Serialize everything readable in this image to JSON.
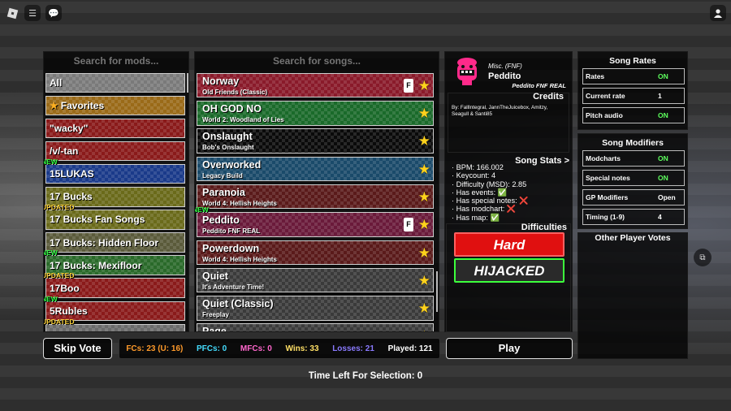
{
  "mods": {
    "search_placeholder": "Search for mods...",
    "items": [
      {
        "label": "All",
        "tag": "",
        "star": false,
        "color": "#7a7a7a"
      },
      {
        "label": "Favorites",
        "tag": "",
        "star": true,
        "color": "#9a6a18"
      },
      {
        "label": "\"wacky\"",
        "tag": "",
        "star": false,
        "color": "#8a1a1a"
      },
      {
        "label": "/v/-tan",
        "tag": "",
        "star": false,
        "color": "#8a1a1a"
      },
      {
        "label": "15LUKAS",
        "tag": "NEW",
        "star": false,
        "color": "#1a3a8a"
      },
      {
        "label": "17 Bucks",
        "tag": "",
        "star": false,
        "color": "#6a6a1a"
      },
      {
        "label": "17 Bucks Fan Songs",
        "tag": "UPDATED",
        "star": false,
        "color": "#6a6a1a"
      },
      {
        "label": "17 Bucks: Hidden Floor",
        "tag": "",
        "star": false,
        "color": "#5a5a3a"
      },
      {
        "label": "17 Bucks: Mexifloor",
        "tag": "NEW",
        "star": false,
        "color": "#2a6a2a"
      },
      {
        "label": "17Boo",
        "tag": "UPDATED",
        "star": false,
        "color": "#8a1a1a"
      },
      {
        "label": "5Rubles",
        "tag": "NEW",
        "star": false,
        "color": "#8a1a1a"
      },
      {
        "label": "",
        "tag": "UPDATED",
        "star": false,
        "color": "#6a6a6a"
      }
    ]
  },
  "songs": {
    "search_placeholder": "Search for songs...",
    "items": [
      {
        "title": "Norway",
        "subtitle": "Old Friends (Classic)",
        "fc": true,
        "tag": "",
        "color": "#8a1a2a"
      },
      {
        "title": "OH GOD NO",
        "subtitle": "World 2: Woodland of Lies",
        "fc": false,
        "tag": "",
        "color": "#1a6a2a"
      },
      {
        "title": "Onslaught",
        "subtitle": "Bob's Onslaught",
        "fc": false,
        "tag": "",
        "color": "#0a0a0a"
      },
      {
        "title": "Overworked",
        "subtitle": "Legacy Build",
        "fc": false,
        "tag": "",
        "color": "#1a4a6a"
      },
      {
        "title": "Paranoia",
        "subtitle": "World 4: Hellish Heights",
        "fc": false,
        "tag": "",
        "color": "#5a1a1a"
      },
      {
        "title": "Peddito",
        "subtitle": "Peddito FNF REAL",
        "fc": true,
        "tag": "NEW",
        "color": "#6a1a3a"
      },
      {
        "title": "Powerdown",
        "subtitle": "World 4: Hellish Heights",
        "fc": false,
        "tag": "",
        "color": "#5a1a1a"
      },
      {
        "title": "Quiet",
        "subtitle": "It's Adventure Time!",
        "fc": false,
        "tag": "",
        "color": "#3a3a3a"
      },
      {
        "title": "Quiet (Classic)",
        "subtitle": "Freeplay",
        "fc": false,
        "tag": "",
        "color": "#3a3a3a"
      },
      {
        "title": "Page",
        "subtitle": "",
        "fc": false,
        "tag": "",
        "color": "#3a3a3a"
      }
    ],
    "fc_icon": "fc-badge-icon"
  },
  "song_info": {
    "category": "Misc. (FNF)",
    "name": "Peddito",
    "mod": "Peddito FNF REAL",
    "credits_title": "Credits",
    "credits": "By: FallIntegral, JannTheJuicebox, Amitzy, Seagull & Santi85",
    "stats_title": "Song Stats >",
    "stats": [
      "· BPM: 166.002",
      "· Keycount: 4",
      "· Difficulty (MSD): 2.85",
      "· Has events: ✅",
      "· Has special notes: ❌",
      "· Has modchart: ❌",
      "· Has map: ✅"
    ],
    "difficulties_title": "Difficulties",
    "difficulties": [
      {
        "label": "Hard",
        "bg": "#e01010",
        "border": "#ff6060",
        "color": "#ffffff"
      },
      {
        "label": "HIJACKED",
        "bg": "#2a2a2a",
        "border": "#3cff3c",
        "color": "#ffffff"
      }
    ]
  },
  "song_rates": {
    "title": "Song Rates",
    "rows": [
      {
        "label": "Rates",
        "value": "ON",
        "on": true
      },
      {
        "label": "Current rate",
        "value": "1",
        "on": false
      },
      {
        "label": "Pitch audio",
        "value": "ON",
        "on": true
      }
    ]
  },
  "song_modifiers": {
    "title": "Song Modifiers",
    "rows": [
      {
        "label": "Modcharts",
        "value": "ON",
        "on": true
      },
      {
        "label": "Special notes",
        "value": "ON",
        "on": true
      },
      {
        "label": "GP Modifiers",
        "value": "Open",
        "on": false
      },
      {
        "label": "Timing (1-9)",
        "value": "4",
        "on": false
      }
    ]
  },
  "other_votes": {
    "title": "Other Player Votes"
  },
  "bottom": {
    "skip_vote": "Skip Vote",
    "play": "Play",
    "stats": [
      {
        "text": "FCs: 23 (U: 16)",
        "color": "#ff9a2a"
      },
      {
        "text": "PFCs: 0",
        "color": "#44ddff"
      },
      {
        "text": "MFCs: 0",
        "color": "#ff66cc"
      },
      {
        "text": "Wins: 33",
        "color": "#ffe066"
      },
      {
        "text": "Losses: 21",
        "color": "#8a7aff"
      },
      {
        "text": "Played: 121",
        "color": "#ffffff"
      }
    ],
    "time_left": "Time Left For Selection: 0"
  },
  "icons": {
    "menu": "hamburger-icon",
    "chat": "chat-icon",
    "logo": "roblox-logo-icon",
    "avatar": "avatar-icon",
    "star": "star-icon",
    "side": "screenshot-icon"
  }
}
